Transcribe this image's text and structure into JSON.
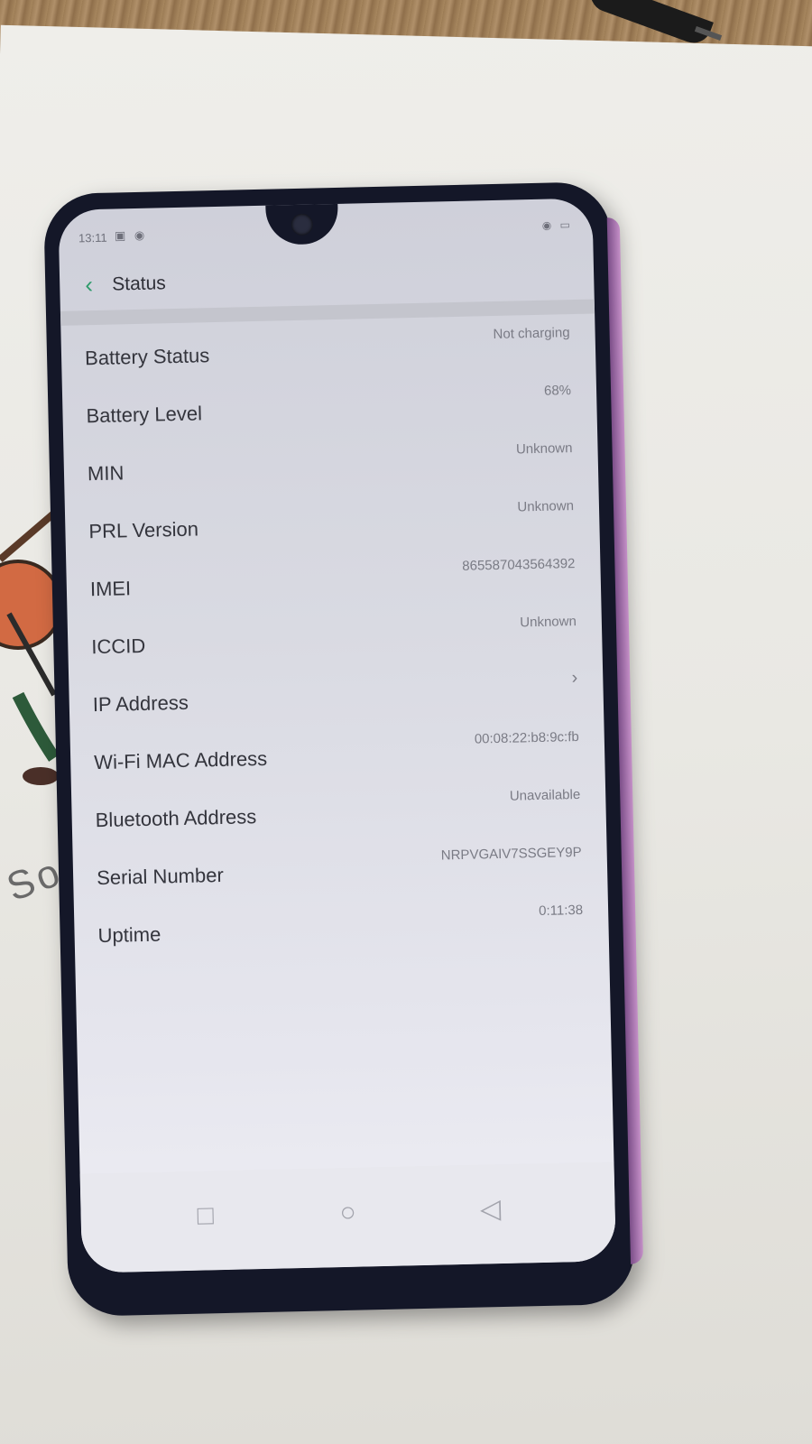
{
  "statusbar": {
    "time": "13:11",
    "left_icons": "▣ ◉",
    "right_icons": "◉ ▭"
  },
  "header": {
    "back_icon": "chevron-left",
    "title": "Status"
  },
  "items": [
    {
      "label": "Battery Status",
      "value": "Not charging"
    },
    {
      "label": "Battery Level",
      "value": "68%"
    },
    {
      "label": "MIN",
      "value": "Unknown"
    },
    {
      "label": "PRL Version",
      "value": "Unknown"
    },
    {
      "label": "IMEI",
      "value": "865587043564392"
    },
    {
      "label": "ICCID",
      "value": "Unknown"
    },
    {
      "label": "IP Address",
      "value": "›"
    },
    {
      "label": "Wi-Fi MAC Address",
      "value": "00:08:22:b8:9c:fb"
    },
    {
      "label": "Bluetooth Address",
      "value": "Unavailable"
    },
    {
      "label": "Serial Number",
      "value": "NRPVGAIV7SSGEY9P"
    },
    {
      "label": "Uptime",
      "value": "0:11:38"
    }
  ],
  "navbar": {
    "recent": "□",
    "home": "○",
    "back": "◁"
  },
  "colors": {
    "accent": "#2e9b6b",
    "screen_bg": "#dcdde5",
    "text": "#34353d",
    "secondary_text": "#7a7b85"
  },
  "background": {
    "paper_letters": "So"
  }
}
